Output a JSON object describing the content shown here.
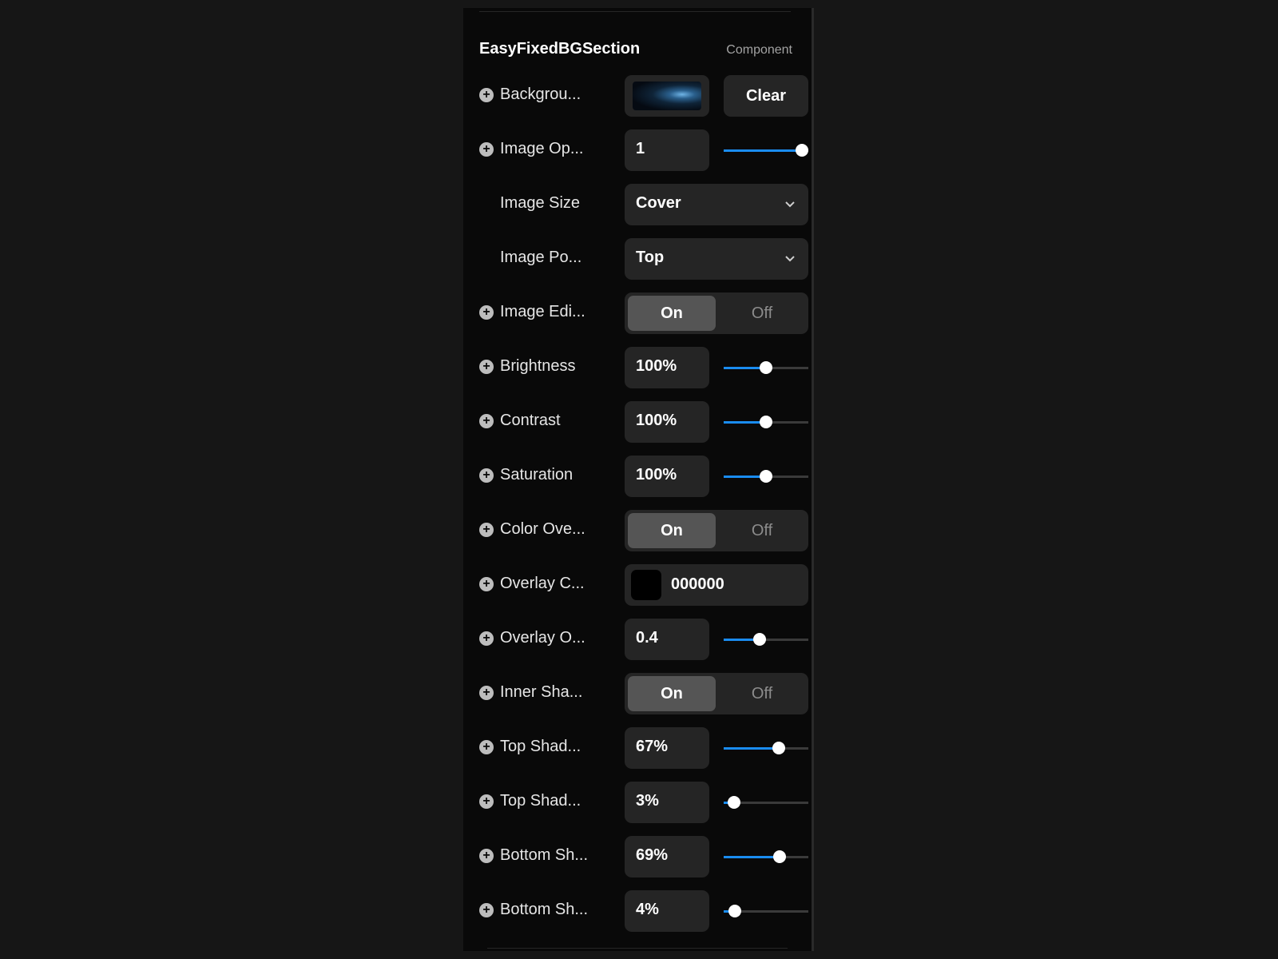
{
  "panel": {
    "title": "EasyFixedBGSection",
    "kind": "Component"
  },
  "background": {
    "label": "Backgrou...",
    "clear_label": "Clear"
  },
  "image_opacity": {
    "label": "Image Op...",
    "value": "1",
    "level": 1.0
  },
  "image_size": {
    "label": "Image Size",
    "value": "Cover"
  },
  "image_position": {
    "label": "Image Po...",
    "value": "Top"
  },
  "image_edit": {
    "label": "Image Edi...",
    "on": "On",
    "off": "Off"
  },
  "brightness": {
    "label": "Brightness",
    "value": "100%",
    "level": 0.5
  },
  "contrast": {
    "label": "Contrast",
    "value": "100%",
    "level": 0.5
  },
  "saturation": {
    "label": "Saturation",
    "value": "100%",
    "level": 0.5
  },
  "color_overlay": {
    "label": "Color Ove...",
    "on": "On",
    "off": "Off"
  },
  "overlay_color": {
    "label": "Overlay C...",
    "value": "000000",
    "swatch": "#000000"
  },
  "overlay_opacity": {
    "label": "Overlay O...",
    "value": "0.4",
    "level": 0.42
  },
  "inner_shadow": {
    "label": "Inner Sha...",
    "on": "On",
    "off": "Off"
  },
  "top_shadow_1": {
    "label": "Top Shad...",
    "value": "67%",
    "level": 0.65
  },
  "top_shadow_2": {
    "label": "Top Shad...",
    "value": "3%",
    "level": 0.12
  },
  "bottom_shadow_1": {
    "label": "Bottom Sh...",
    "value": "69%",
    "level": 0.66
  },
  "bottom_shadow_2": {
    "label": "Bottom Sh...",
    "value": "4%",
    "level": 0.13
  },
  "colors": {
    "accent": "#1a8cf0",
    "panel": "#090909",
    "field": "#252525"
  },
  "icons": {
    "add": "plus-circle-icon",
    "dropdown": "chevron-down-icon"
  }
}
